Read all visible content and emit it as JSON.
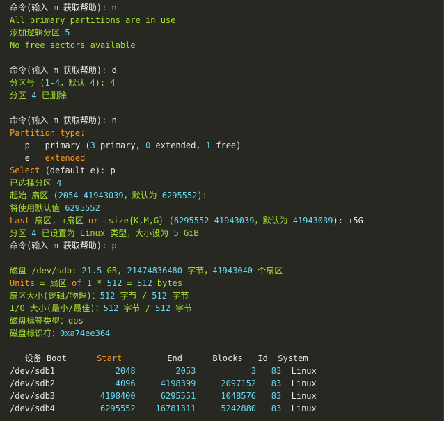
{
  "colors": {
    "background": "#272822",
    "text": "#e6e6e6",
    "green": "#a6e22e",
    "number": "#66d9ef",
    "keyword": "#fd971f",
    "accent": "#ae81ff"
  },
  "lines": [
    [
      {
        "t": "命令(输入 m 获取帮助): n",
        "c": "default"
      }
    ],
    [
      {
        "t": "All primary partitions are in use",
        "c": "green"
      }
    ],
    [
      {
        "t": "添加逻辑分区 ",
        "c": "green"
      },
      {
        "t": "5",
        "c": "number"
      }
    ],
    [
      {
        "t": "No free sectors available",
        "c": "green"
      }
    ],
    [
      {
        "t": "",
        "c": "default"
      }
    ],
    [
      {
        "t": "命令(输入 m 获取帮助): d",
        "c": "default"
      }
    ],
    [
      {
        "t": "分区号 (",
        "c": "green"
      },
      {
        "t": "1-4",
        "c": "number"
      },
      {
        "t": "，默认 ",
        "c": "green"
      },
      {
        "t": "4",
        "c": "number"
      },
      {
        "t": "): ",
        "c": "green"
      },
      {
        "t": "4",
        "c": "number"
      }
    ],
    [
      {
        "t": "分区 ",
        "c": "green"
      },
      {
        "t": "4",
        "c": "number"
      },
      {
        "t": " 已删除",
        "c": "green"
      }
    ],
    [
      {
        "t": "",
        "c": "default"
      }
    ],
    [
      {
        "t": "命令(输入 m 获取帮助): n",
        "c": "default"
      }
    ],
    [
      {
        "t": "Partition type:",
        "c": "keyword"
      }
    ],
    [
      {
        "t": "   p   primary (",
        "c": "default"
      },
      {
        "t": "3",
        "c": "number"
      },
      {
        "t": " primary, ",
        "c": "default"
      },
      {
        "t": "0",
        "c": "number"
      },
      {
        "t": " extended, ",
        "c": "default"
      },
      {
        "t": "1",
        "c": "number"
      },
      {
        "t": " free)",
        "c": "default"
      }
    ],
    [
      {
        "t": "   e   ",
        "c": "default"
      },
      {
        "t": "extended",
        "c": "keyword"
      }
    ],
    [
      {
        "t": "Select",
        "c": "keyword"
      },
      {
        "t": " (default e): p",
        "c": "default"
      }
    ],
    [
      {
        "t": "已选择分区 ",
        "c": "green"
      },
      {
        "t": "4",
        "c": "number"
      }
    ],
    [
      {
        "t": "起始 扇区 (",
        "c": "green"
      },
      {
        "t": "2054-41943039",
        "c": "number"
      },
      {
        "t": "，默认为 ",
        "c": "green"
      },
      {
        "t": "6295552",
        "c": "number"
      },
      {
        "t": "):",
        "c": "green"
      }
    ],
    [
      {
        "t": "将使用默认值 ",
        "c": "green"
      },
      {
        "t": "6295552",
        "c": "number"
      }
    ],
    [
      {
        "t": "Last",
        "c": "keyword"
      },
      {
        "t": " 扇区, +扇区 ",
        "c": "green"
      },
      {
        "t": "or",
        "c": "keyword"
      },
      {
        "t": " +size{K,M,G} (",
        "c": "green"
      },
      {
        "t": "6295552-41943039",
        "c": "number"
      },
      {
        "t": "，默认为 ",
        "c": "green"
      },
      {
        "t": "41943039",
        "c": "number"
      },
      {
        "t": "): +5G",
        "c": "default"
      }
    ],
    [
      {
        "t": "分区 ",
        "c": "green"
      },
      {
        "t": "4",
        "c": "number"
      },
      {
        "t": " 已设置为 Linux 类型，大小设为 ",
        "c": "green"
      },
      {
        "t": "5",
        "c": "number"
      },
      {
        "t": " GiB",
        "c": "green"
      }
    ],
    [
      {
        "t": "命令(输入 m 获取帮助): p",
        "c": "default"
      }
    ],
    [
      {
        "t": "",
        "c": "default"
      }
    ],
    [
      {
        "t": "磁盘 /dev/sdb: ",
        "c": "green"
      },
      {
        "t": "21.5",
        "c": "number"
      },
      {
        "t": " GB, ",
        "c": "green"
      },
      {
        "t": "21474836480",
        "c": "number"
      },
      {
        "t": " 字节，",
        "c": "green"
      },
      {
        "t": "41943040",
        "c": "number"
      },
      {
        "t": " 个扇区",
        "c": "green"
      }
    ],
    [
      {
        "t": "Units",
        "c": "keyword"
      },
      {
        "t": " = 扇区 ",
        "c": "green"
      },
      {
        "t": "of",
        "c": "keyword"
      },
      {
        "t": " ",
        "c": "green"
      },
      {
        "t": "1",
        "c": "number"
      },
      {
        "t": " * ",
        "c": "green"
      },
      {
        "t": "512",
        "c": "number"
      },
      {
        "t": " = ",
        "c": "green"
      },
      {
        "t": "512",
        "c": "number"
      },
      {
        "t": " bytes",
        "c": "green"
      }
    ],
    [
      {
        "t": "扇区大小(逻辑/物理)：",
        "c": "green"
      },
      {
        "t": "512",
        "c": "number"
      },
      {
        "t": " 字节 / ",
        "c": "green"
      },
      {
        "t": "512",
        "c": "number"
      },
      {
        "t": " 字节",
        "c": "green"
      }
    ],
    [
      {
        "t": "I/O 大小(最小/最佳)：",
        "c": "green"
      },
      {
        "t": "512",
        "c": "number"
      },
      {
        "t": " 字节 / ",
        "c": "green"
      },
      {
        "t": "512",
        "c": "number"
      },
      {
        "t": " 字节",
        "c": "green"
      }
    ],
    [
      {
        "t": "磁盘标签类型：dos",
        "c": "green"
      }
    ],
    [
      {
        "t": "磁盘标识符：",
        "c": "green"
      },
      {
        "t": "0xa74ee364",
        "c": "number"
      }
    ],
    [
      {
        "t": "",
        "c": "default"
      }
    ],
    [
      {
        "t": "   设备 Boot      ",
        "c": "default"
      },
      {
        "t": "Start",
        "c": "keyword"
      },
      {
        "t": "         End      Blocks   Id  System",
        "c": "default"
      }
    ],
    [
      {
        "t": "/dev/sdb1            ",
        "c": "default"
      },
      {
        "t": "2048",
        "c": "number"
      },
      {
        "t": "        ",
        "c": "default"
      },
      {
        "t": "2053",
        "c": "number"
      },
      {
        "t": "           ",
        "c": "default"
      },
      {
        "t": "3",
        "c": "number"
      },
      {
        "t": "   ",
        "c": "default"
      },
      {
        "t": "83",
        "c": "number"
      },
      {
        "t": "  Linux",
        "c": "default"
      }
    ],
    [
      {
        "t": "/dev/sdb2            ",
        "c": "default"
      },
      {
        "t": "4096",
        "c": "number"
      },
      {
        "t": "     ",
        "c": "default"
      },
      {
        "t": "4198399",
        "c": "number"
      },
      {
        "t": "     ",
        "c": "default"
      },
      {
        "t": "2097152",
        "c": "number"
      },
      {
        "t": "   ",
        "c": "default"
      },
      {
        "t": "83",
        "c": "number"
      },
      {
        "t": "  Linux",
        "c": "default"
      }
    ],
    [
      {
        "t": "/dev/sdb3         ",
        "c": "default"
      },
      {
        "t": "4198400",
        "c": "number"
      },
      {
        "t": "     ",
        "c": "default"
      },
      {
        "t": "6295551",
        "c": "number"
      },
      {
        "t": "     ",
        "c": "default"
      },
      {
        "t": "1048576",
        "c": "number"
      },
      {
        "t": "   ",
        "c": "default"
      },
      {
        "t": "83",
        "c": "number"
      },
      {
        "t": "  Linux",
        "c": "default"
      }
    ],
    [
      {
        "t": "/dev/sdb4         ",
        "c": "default"
      },
      {
        "t": "6295552",
        "c": "number"
      },
      {
        "t": "    ",
        "c": "default"
      },
      {
        "t": "16781311",
        "c": "number"
      },
      {
        "t": "     ",
        "c": "default"
      },
      {
        "t": "5242880",
        "c": "number"
      },
      {
        "t": "   ",
        "c": "default"
      },
      {
        "t": "83",
        "c": "number"
      },
      {
        "t": "  Linux",
        "c": "default"
      }
    ]
  ]
}
